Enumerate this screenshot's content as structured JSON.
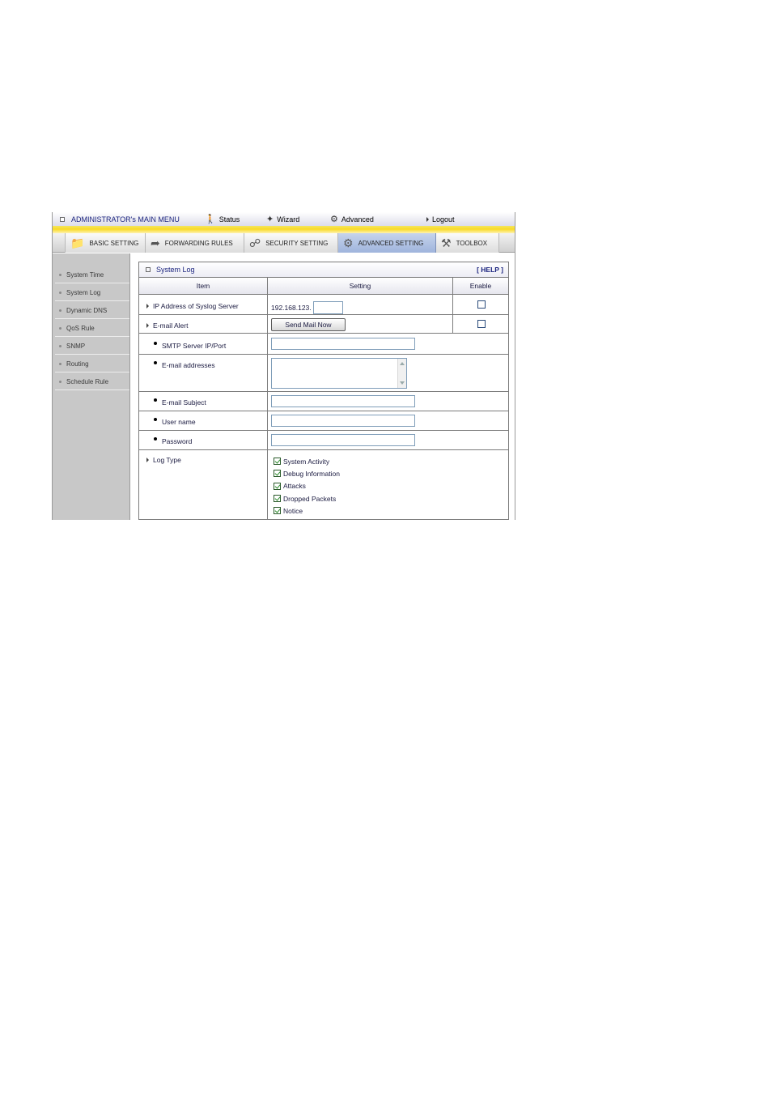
{
  "topmenu": {
    "admin": "ADMINISTRATOR's MAIN MENU",
    "status": "Status",
    "wizard": "Wizard",
    "advanced": "Advanced",
    "logout": "Logout"
  },
  "tabs": [
    {
      "label": "BASIC SETTING",
      "icon": "folder-icon"
    },
    {
      "label": "FORWARDING RULES",
      "icon": "forwarding-icon"
    },
    {
      "label": "SECURITY SETTING",
      "icon": "security-icon"
    },
    {
      "label": "ADVANCED SETTING",
      "icon": "advanced-icon",
      "active": true
    },
    {
      "label": "TOOLBOX",
      "icon": "toolbox-icon"
    }
  ],
  "sidebar": {
    "items": [
      {
        "label": "System Time"
      },
      {
        "label": "System Log"
      },
      {
        "label": "Dynamic DNS"
      },
      {
        "label": "QoS Rule"
      },
      {
        "label": "SNMP"
      },
      {
        "label": "Routing"
      },
      {
        "label": "Schedule Rule"
      }
    ]
  },
  "panel": {
    "title": "System Log",
    "help": "[ HELP ]",
    "headers": {
      "item": "Item",
      "setting": "Setting",
      "enable": "Enable"
    },
    "syslog": {
      "label": "IP Address of Syslog Server",
      "prefix": "192.168.123.",
      "value": "",
      "enabled": false
    },
    "email_alert": {
      "label": "E-mail Alert",
      "button": "Send Mail Now",
      "enabled": false
    },
    "smtp": {
      "label": "SMTP Server IP/Port",
      "value": ""
    },
    "addresses": {
      "label": "E-mail addresses",
      "value": ""
    },
    "subject": {
      "label": "E-mail Subject",
      "value": ""
    },
    "username": {
      "label": "User name",
      "value": ""
    },
    "password": {
      "label": "Password",
      "value": ""
    },
    "logtype": {
      "label": "Log Type",
      "options": [
        {
          "label": "System Activity",
          "checked": true
        },
        {
          "label": "Debug Information",
          "checked": true
        },
        {
          "label": "Attacks",
          "checked": true
        },
        {
          "label": "Dropped Packets",
          "checked": true
        },
        {
          "label": "Notice",
          "checked": true
        }
      ]
    }
  },
  "colors": {
    "accent_yellow": "#f9d928",
    "link_navy": "#1a237e",
    "sidebar_gray": "#c8c8c8",
    "active_tab": "#9fb4dc"
  }
}
